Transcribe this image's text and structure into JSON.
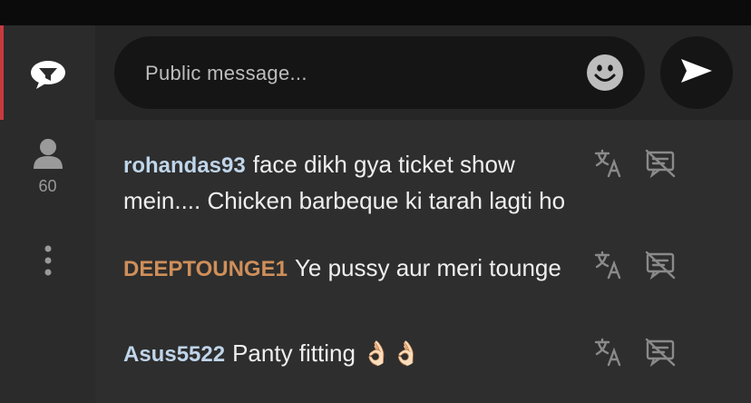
{
  "sidebar": {
    "chat_icon": "chat-bubble-icon",
    "users_icon": "user-icon",
    "users_count": "60",
    "more_icon": "more-vertical-icon",
    "active_color": "#c93a3f"
  },
  "composer": {
    "placeholder": "Public message...",
    "emoji_icon": "smiley-icon",
    "send_icon": "send-arrow-icon"
  },
  "messages": [
    {
      "username": "rohandas93",
      "username_color": "#bfd5ea",
      "text": "face dikh gya ticket show mein.... Chicken barbeque ki tarah lagti ho"
    },
    {
      "username": "DEEPTOUNGE1",
      "username_color": "#cf8f5a",
      "text": "Ye pussy aur meri tounge"
    },
    {
      "username": "Asus5522",
      "username_color": "#bfd5ea",
      "text": "Panty fitting 👌🏻👌🏻"
    }
  ],
  "message_actions": {
    "translate_icon": "translate-icon",
    "hide_icon": "hide-message-icon"
  }
}
